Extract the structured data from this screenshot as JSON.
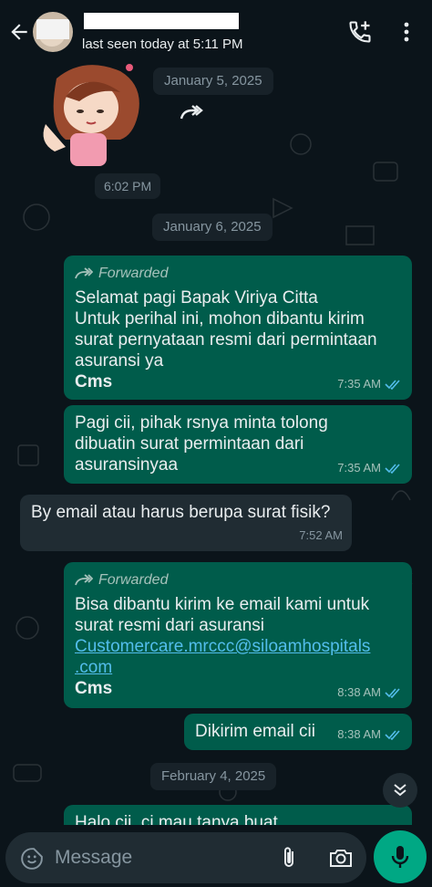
{
  "header": {
    "last_seen": "last seen today at 5:11 PM"
  },
  "chat": {
    "dates": {
      "jan5": "January 5, 2025",
      "jan6": "January 6, 2025",
      "feb4": "February 4, 2025"
    },
    "sticker_time": "6:02 PM",
    "messages": [
      {
        "forwarded_label": "Forwarded",
        "lines": [
          "Selamat pagi Bapak Viriya Citta",
          "Untuk perihal ini, mohon dibantu kirim",
          "surat pernyataan resmi dari permintaan",
          "asuransi ya"
        ],
        "signature": "Cms",
        "time": "7:35 AM"
      },
      {
        "lines": [
          "Pagi cii, pihak rsnya minta tolong",
          "dibuatin surat permintaan dari",
          "asuransinyaa"
        ],
        "time": "7:35 AM"
      },
      {
        "lines": [
          "By email atau harus berupa surat fisik?"
        ],
        "time": "7:52 AM"
      },
      {
        "forwarded_label": "Forwarded",
        "lines": [
          "Bisa dibantu kirim ke email kami untuk",
          "surat resmi dari asuransi"
        ],
        "link_1": "Customercare.mrccc@siloamhospitals",
        "link_2": ".com",
        "signature": "Cms",
        "time": "8:38 AM"
      },
      {
        "lines": [
          "Dikirim email cii"
        ],
        "time": "8:38 AM"
      },
      {
        "partial": "Halo cii, ci mau tanya buat"
      }
    ]
  },
  "composer": {
    "placeholder": "Message"
  },
  "colors": {
    "outgoing": "#005c4b",
    "incoming": "#202c33",
    "read_ticks": "#53bdeb",
    "mic": "#00a884"
  }
}
